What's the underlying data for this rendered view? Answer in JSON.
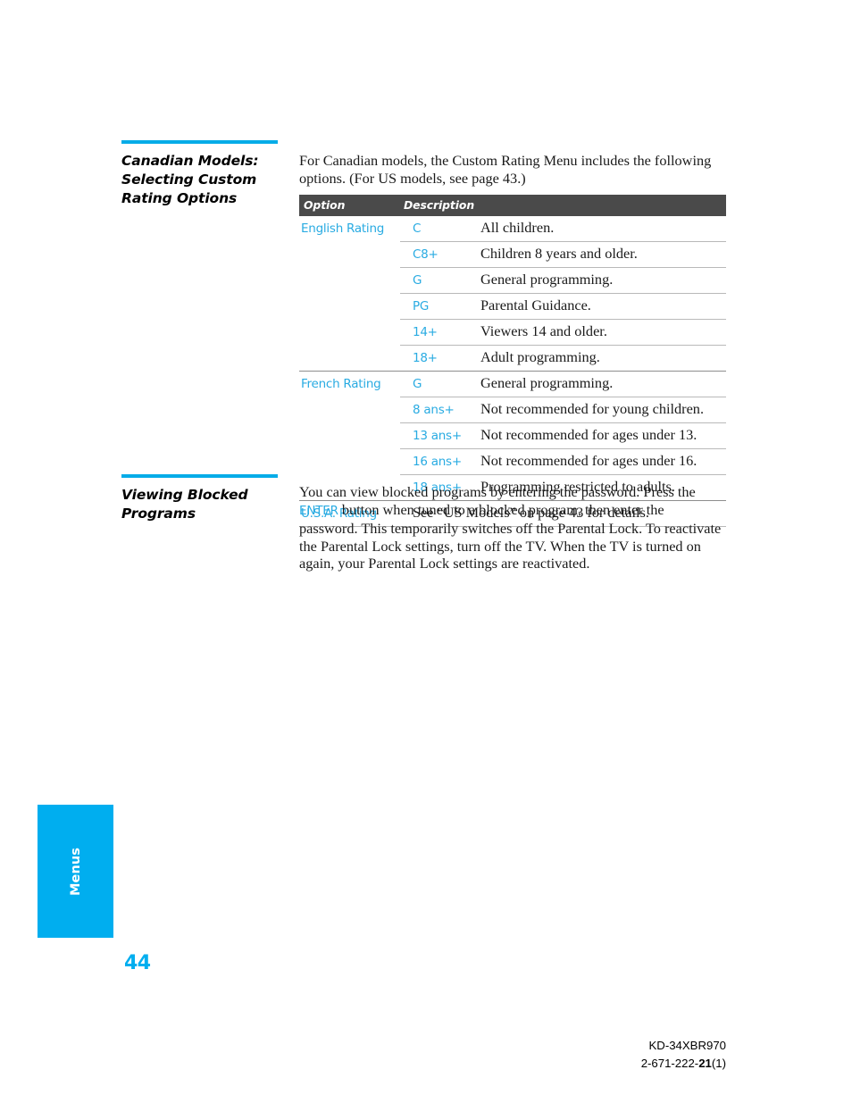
{
  "page": {
    "number": "44",
    "side_tab_label": "Menus"
  },
  "sections": [
    {
      "title": "Canadian Models: Selecting Custom Rating Options",
      "intro": "For Canadian models, the Custom Rating Menu includes the following options. (For US models, see page 43.)"
    },
    {
      "title": "Viewing Blocked Programs",
      "body_part1": "You can view blocked programs by entering the password. Press the ",
      "body_term": "ENTER",
      "body_part2": " button when tuned to a blocked program, then enter the password. This temporarily switches off the Parental Lock. To reactivate the Parental Lock settings, turn off the TV. When the TV is turned on again, your Parental Lock settings are reactivated."
    }
  ],
  "table": {
    "header": {
      "option": "Option",
      "description": "Description"
    },
    "groups": [
      {
        "label": "English Rating",
        "rows": [
          {
            "code": "C",
            "description": "All children."
          },
          {
            "code": "C8+",
            "description": "Children 8 years and older."
          },
          {
            "code": "G",
            "description": "General programming."
          },
          {
            "code": "PG",
            "description": "Parental Guidance."
          },
          {
            "code": "14+",
            "description": "Viewers 14 and older."
          },
          {
            "code": "18+",
            "description": "Adult programming."
          }
        ]
      },
      {
        "label": "French Rating",
        "rows": [
          {
            "code": "G",
            "description": "General programming."
          },
          {
            "code": "8 ans+",
            "description": "Not recommended for young children."
          },
          {
            "code": "13 ans+",
            "description": "Not recommended for ages under 13."
          },
          {
            "code": "16 ans+",
            "description": "Not recommended for ages under 16."
          },
          {
            "code": "18 ans+",
            "description": "Programming restricted to adults."
          }
        ]
      },
      {
        "label": "U.S.A. Rating",
        "spanned_text": "See “US Models” on page 43 for details."
      }
    ]
  },
  "footer": {
    "model": "KD-34XBR970",
    "part_prefix": "2-671-222-",
    "part_bold": "21",
    "part_suffix": "(1)"
  },
  "colors": {
    "accent_cyan": "#00AEEF",
    "label_cyan": "#29ABE2",
    "table_header_bg": "#4A4A4A",
    "rule_gray": "#b9b9b9"
  }
}
